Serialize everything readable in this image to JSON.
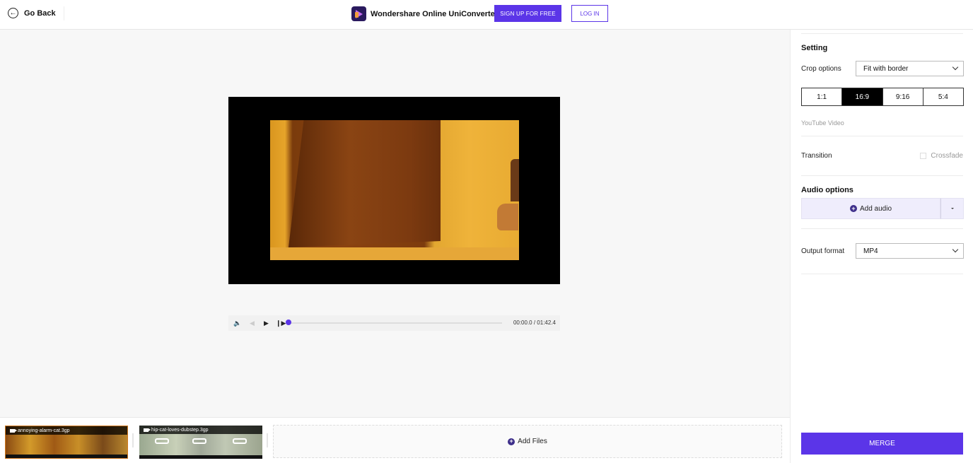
{
  "header": {
    "go_back_label": "Go Back",
    "brand_name": "Wondershare Online UniConverter",
    "signup_label": "SIGN UP FOR FREE",
    "login_label": "LOG IN"
  },
  "player": {
    "current_time": "00:00.0",
    "separator": "/",
    "duration": "01:42.4",
    "time_display": "00:00.0 / 01:42.4",
    "progress_percent": 0
  },
  "clips": [
    {
      "filename": "annoying-alarm-cat.3gp",
      "selected": true
    },
    {
      "filename": "hip-cat-loves-dubstep.3gp",
      "selected": false
    }
  ],
  "add_files_label": "Add Files",
  "settings": {
    "title": "Setting",
    "crop_label": "Crop options",
    "crop_value": "Fit with border",
    "ratios": [
      {
        "label": "1:1",
        "active": false
      },
      {
        "label": "16:9",
        "active": true
      },
      {
        "label": "9:16",
        "active": false
      },
      {
        "label": "5:4",
        "active": false
      }
    ],
    "ratio_hint": "YouTube Video",
    "transition_label": "Transition",
    "crossfade_label": "Crossfade",
    "crossfade_checked": false,
    "audio_title": "Audio options",
    "add_audio_label": "Add audio",
    "output_label": "Output format",
    "output_value": "MP4",
    "merge_label": "MERGE"
  },
  "colors": {
    "accent": "#5b35e8",
    "audio_bg": "#efedfc"
  }
}
